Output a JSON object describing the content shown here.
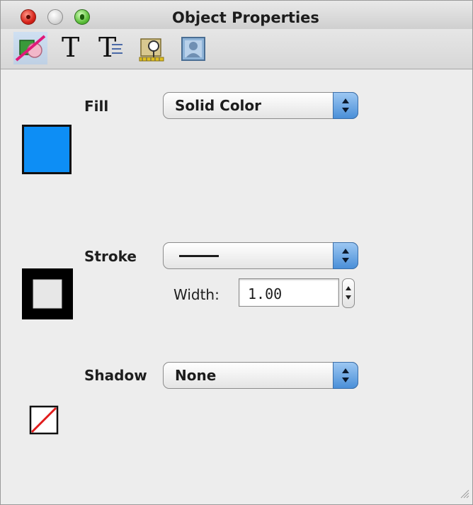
{
  "window": {
    "title": "Object Properties"
  },
  "toolbar": {
    "tools": [
      {
        "name": "fill-stroke-inspector",
        "selected": true
      },
      {
        "name": "text-inspector",
        "glyph": "T"
      },
      {
        "name": "text-layout-inspector",
        "glyph": "T"
      },
      {
        "name": "image-inspector"
      },
      {
        "name": "photo-inspector"
      }
    ]
  },
  "fill": {
    "label": "Fill",
    "value": "Solid Color",
    "swatch_color": "#0d8ef5"
  },
  "stroke": {
    "label": "Stroke",
    "width_label": "Width:",
    "width_value": "1.00"
  },
  "shadow": {
    "label": "Shadow",
    "value": "None"
  },
  "colors": {
    "accent": "#4a8fd8",
    "background": "#ededed",
    "no_shadow_slash": "#e11b1b"
  }
}
